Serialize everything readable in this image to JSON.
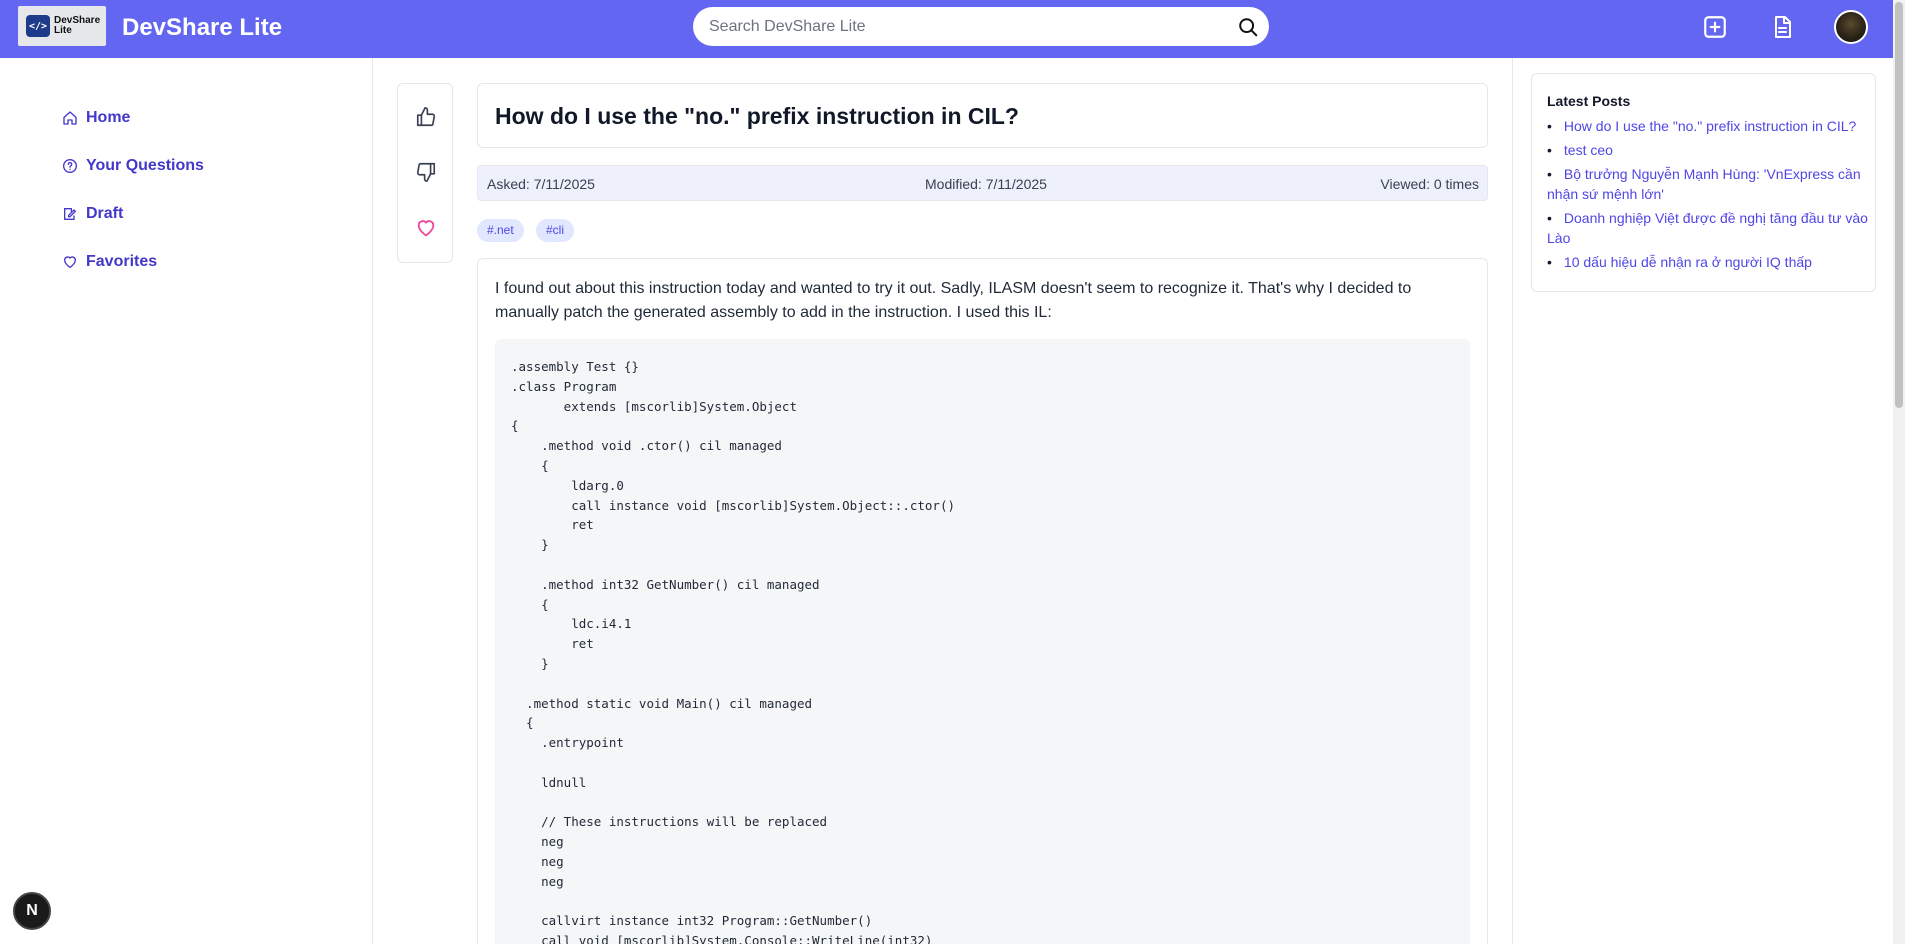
{
  "header": {
    "logo_text": "DevShare Lite",
    "app_title": "DevShare Lite",
    "search_placeholder": "Search DevShare Lite"
  },
  "sidebar": {
    "items": [
      {
        "label": "Home",
        "icon": "home-icon"
      },
      {
        "label": "Your Questions",
        "icon": "question-circle-icon"
      },
      {
        "label": "Draft",
        "icon": "edit-note-icon"
      },
      {
        "label": "Favorites",
        "icon": "heart-icon"
      }
    ]
  },
  "post": {
    "title": "How do I use the \"no.\" prefix instruction in CIL?",
    "asked": "Asked: 7/11/2025",
    "modified": "Modified: 7/11/2025",
    "viewed": "Viewed: 0 times",
    "tags": [
      "#.net",
      "#cli"
    ],
    "body_text": "I found out about this instruction today and wanted to try it out. Sadly, ILASM doesn't seem to recognize it. That's why I decided to manually patch the generated assembly to add in the instruction. I used this IL:",
    "code": ".assembly Test {}\n.class Program\n       extends [mscorlib]System.Object\n{\n    .method void .ctor() cil managed\n    {\n        ldarg.0\n        call instance void [mscorlib]System.Object::.ctor()\n        ret\n    }\n\n    .method int32 GetNumber() cil managed\n    {\n        ldc.i4.1\n        ret\n    }\n\n  .method static void Main() cil managed\n  {\n    .entrypoint\n\n    ldnull\n\n    // These instructions will be replaced\n    neg\n    neg\n    neg\n\n    callvirt instance int32 Program::GetNumber()\n    call void [mscorlib]System.Console::WriteLine(int32)"
  },
  "latest": {
    "title": "Latest Posts",
    "items": [
      "How do I use the \"no.\" prefix instruction in CIL?",
      "test ceo",
      "Bộ trưởng Nguyễn Mạnh Hùng: 'VnExpress cần nhận sứ mệnh lớn'",
      "Doanh nghiệp Việt được đề nghị tăng đầu tư vào Lào",
      "10 dấu hiệu dễ nhận ra ở người IQ thấp"
    ]
  },
  "badge": "N",
  "colors": {
    "header_bg": "#6366f1",
    "accent": "#4338ca",
    "link": "#4f46e5",
    "heart": "#ec4899"
  }
}
